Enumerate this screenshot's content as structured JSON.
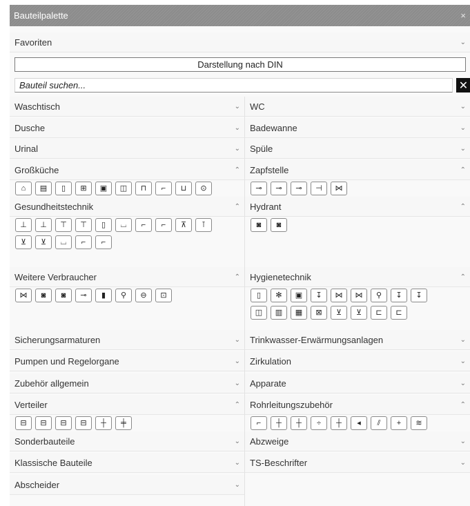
{
  "window": {
    "title": "Bauteilpalette",
    "close_glyph": "×"
  },
  "favoriten": {
    "label": "Favoriten"
  },
  "darstellung_button": {
    "label": "Darstellung nach DIN"
  },
  "search": {
    "placeholder": "Bauteil suchen...",
    "clear_glyph": "✕"
  },
  "chevrons": {
    "expanded": "⌃",
    "collapsed": "⌄"
  },
  "left_sections": [
    {
      "label": "Waschtisch",
      "expanded": false
    },
    {
      "label": "Dusche",
      "expanded": false
    },
    {
      "label": "Urinal",
      "expanded": false
    },
    {
      "label": "Großküche",
      "expanded": true,
      "icons": [
        "oven-icon",
        "fryer-icon",
        "cabinet-icon",
        "dishwasher-icon",
        "cooler-icon",
        "combi-steamer-icon",
        "table-icon",
        "tap-icon",
        "sink-unit-icon",
        "pump-unit-icon"
      ]
    },
    {
      "label": "Gesundheitstechnik",
      "expanded": true,
      "icons": [
        "treatment-basin-icon",
        "treatment-basin-icon",
        "bath-unit-icon",
        "bath-unit-icon",
        "cabinet-icon",
        "bath-tub-icon",
        "shower-arm-icon",
        "shower-arm-icon",
        "shower-head-icon",
        "dental-unit-icon",
        "foot-bath-icon",
        "sitz-bath-icon",
        "tub-icon",
        "tap-icon",
        "tap-icon"
      ]
    },
    {
      "label": "Weitere Verbraucher",
      "expanded": true,
      "icons": [
        "valve-icon",
        "drain-icon",
        "drain-icon",
        "connector-icon",
        "boiler-icon",
        "fountain-icon",
        "meter-icon",
        "outlet-icon"
      ]
    },
    {
      "label": "Sicherungsarmaturen",
      "expanded": false
    },
    {
      "label": "Pumpen und Regelorgane",
      "expanded": false
    },
    {
      "label": "Zubehör allgemein",
      "expanded": false
    },
    {
      "label": "Verteiler",
      "expanded": true,
      "icons": [
        "manifold-icon",
        "manifold-icon",
        "manifold-icon",
        "manifold-icon",
        "cross-icon",
        "double-cross-icon"
      ]
    },
    {
      "label": "Sonderbauteile",
      "expanded": false
    },
    {
      "label": "Klassische Bauteile",
      "expanded": false
    },
    {
      "label": "Abscheider",
      "expanded": false
    }
  ],
  "right_sections": [
    {
      "label": "WC",
      "expanded": false
    },
    {
      "label": "Badewanne",
      "expanded": false
    },
    {
      "label": "Spüle",
      "expanded": false
    },
    {
      "label": "Zapfstelle",
      "expanded": true,
      "icons": [
        "tap-valve-icon",
        "tap-valve-icon",
        "hose-tap-icon",
        "wall-tap-icon",
        "hose-connection-icon"
      ]
    },
    {
      "label": "Hydrant",
      "expanded": true,
      "icons": [
        "hydrant-icon",
        "hydrant-icon"
      ]
    },
    {
      "label": "Hygienetechnik",
      "expanded": true,
      "icons": [
        "flush-icon",
        "snowflake-icon",
        "disinfection-icon",
        "sensor-icon",
        "flow-valve-icon",
        "flow-valve-icon",
        "dosing-icon",
        "sensor-icon",
        "sensor-icon",
        "panel-icon",
        "heat-panel-icon",
        "uv-icon",
        "filter-icon",
        "separator-icon",
        "separator-icon",
        "tray-icon",
        "tray-icon"
      ]
    },
    {
      "label": "Trinkwasser-Erwärmungsanlagen",
      "expanded": false
    },
    {
      "label": "Zirkulation",
      "expanded": false
    },
    {
      "label": "Apparate",
      "expanded": false
    },
    {
      "label": "Rohrleitungszubehör",
      "expanded": true,
      "icons": [
        "elbow-icon",
        "tee-icon",
        "tee-icon",
        "reducer-icon",
        "cross-fitting-icon",
        "arrow-icon",
        "compensator-icon",
        "plus-icon",
        "coil-icon"
      ]
    },
    {
      "label": "Abzweige",
      "expanded": false
    },
    {
      "label": "TS-Beschrifter",
      "expanded": false
    }
  ]
}
